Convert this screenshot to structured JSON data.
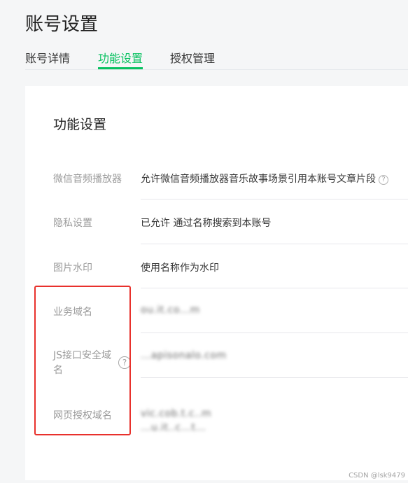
{
  "page_title": "账号设置",
  "tabs": [
    {
      "label": "账号详情",
      "active": false
    },
    {
      "label": "功能设置",
      "active": true
    },
    {
      "label": "授权管理",
      "active": false
    }
  ],
  "section_title": "功能设置",
  "rows": [
    {
      "label": "微信音频播放器",
      "value": "允许微信音频播放器音乐故事场景引用本账号文章片段"
    },
    {
      "label": "隐私设置",
      "value": "已允许 通过名称搜索到本账号"
    },
    {
      "label": "图片水印",
      "value": "使用名称作为水印"
    },
    {
      "label": "业务域名",
      "value": "ou.it.co...m"
    },
    {
      "label": "JS接口安全域名",
      "label_line1": "JS接口安全域",
      "label_line2": "名",
      "value": "...apisonalo.com"
    },
    {
      "label": "网页授权域名",
      "value": "vic.cob.t.c..m",
      "value2": "...u.it..c...t..."
    }
  ],
  "watermark": "CSDN @lsk9479",
  "colors": {
    "accent": "#07c160",
    "highlight_box": "#e8312c",
    "label_gray": "#9a9a9a"
  }
}
